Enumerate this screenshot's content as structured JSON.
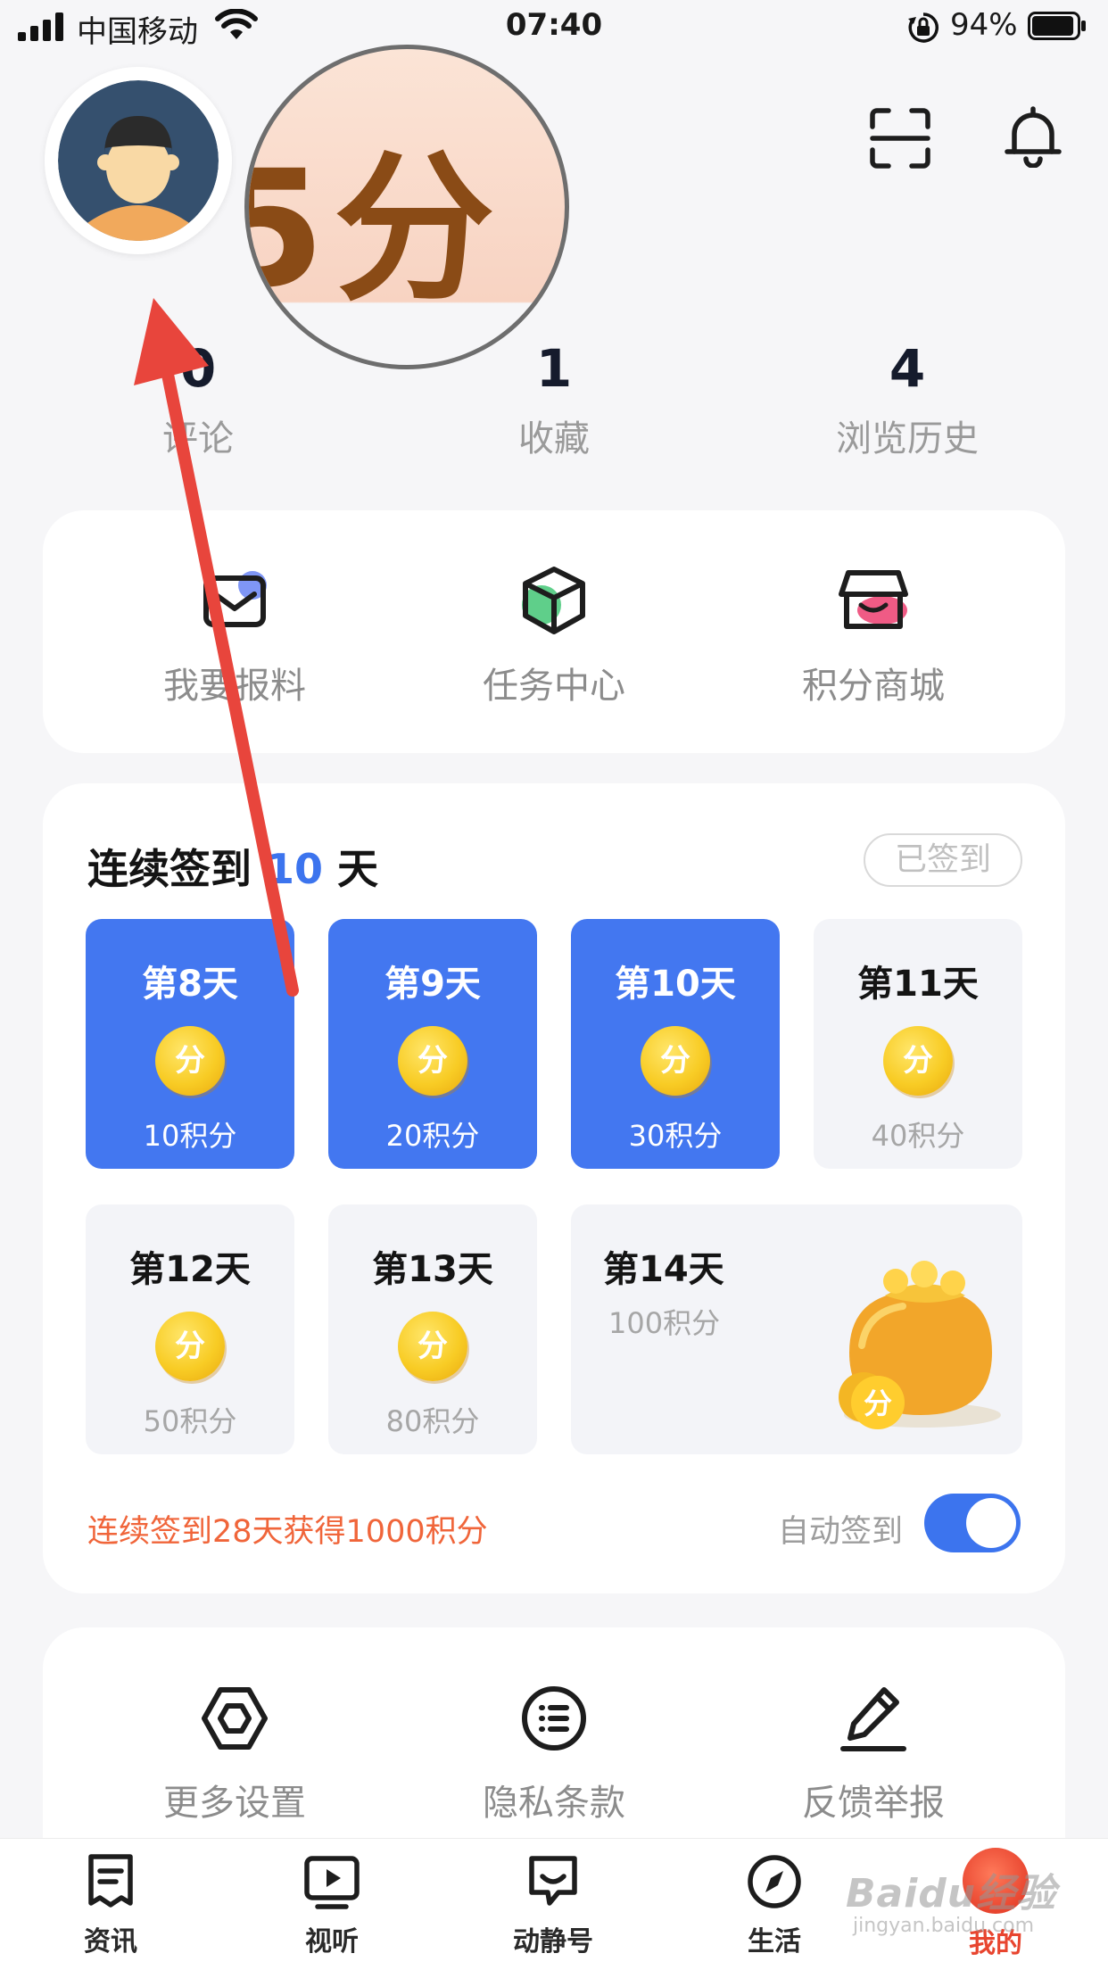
{
  "status_bar": {
    "carrier": "中国移动",
    "time": "07:40",
    "battery_percent": "94%",
    "battery_level": 0.94
  },
  "header": {
    "magnified_text": "5分",
    "icons": [
      "scan-icon",
      "bell-icon"
    ]
  },
  "stats": [
    {
      "value": "0",
      "label": "评论"
    },
    {
      "value": "1",
      "label": "收藏"
    },
    {
      "value": "4",
      "label": "浏览历史"
    }
  ],
  "quick_actions": [
    {
      "label": "我要报料",
      "icon": "report-mail-icon"
    },
    {
      "label": "任务中心",
      "icon": "task-cube-icon"
    },
    {
      "label": "积分商城",
      "icon": "points-store-icon"
    }
  ],
  "signin": {
    "title_prefix": "连续签到",
    "days_count": "10",
    "title_suffix": "天",
    "signed_label": "已签到",
    "coin_label": "分",
    "days": [
      {
        "title": "第8天",
        "points": "10积分",
        "done": true
      },
      {
        "title": "第9天",
        "points": "20积分",
        "done": true
      },
      {
        "title": "第10天",
        "points": "30积分",
        "done": true
      },
      {
        "title": "第11天",
        "points": "40积分",
        "done": false
      },
      {
        "title": "第12天",
        "points": "50积分",
        "done": false
      },
      {
        "title": "第13天",
        "points": "80积分",
        "done": false
      },
      {
        "title": "第14天",
        "points": "100积分",
        "done": false
      }
    ],
    "bonus_note": "连续签到28天获得1000积分",
    "auto_label": "自动签到",
    "auto_enabled": true
  },
  "settings": [
    {
      "label": "更多设置",
      "icon": "hexagon-settings-icon"
    },
    {
      "label": "隐私条款",
      "icon": "list-circle-icon"
    },
    {
      "label": "反馈举报",
      "icon": "pen-icon"
    }
  ],
  "tabs": [
    {
      "label": "资讯",
      "icon": "news-icon",
      "active": false
    },
    {
      "label": "视听",
      "icon": "video-icon",
      "active": false
    },
    {
      "label": "动静号",
      "icon": "chat-icon",
      "active": false
    },
    {
      "label": "生活",
      "icon": "compass-icon",
      "active": false
    },
    {
      "label": "我的",
      "icon": "profile-icon",
      "active": true
    }
  ],
  "watermark": {
    "text": "Baidu经验",
    "sub": "jingyan.baidu.com"
  },
  "colors": {
    "accent": "#4377f0",
    "highlight": "#3c74ee",
    "warning": "#f0653a",
    "active_tab": "#e8452f",
    "annotation_arrow": "#e8453c"
  }
}
